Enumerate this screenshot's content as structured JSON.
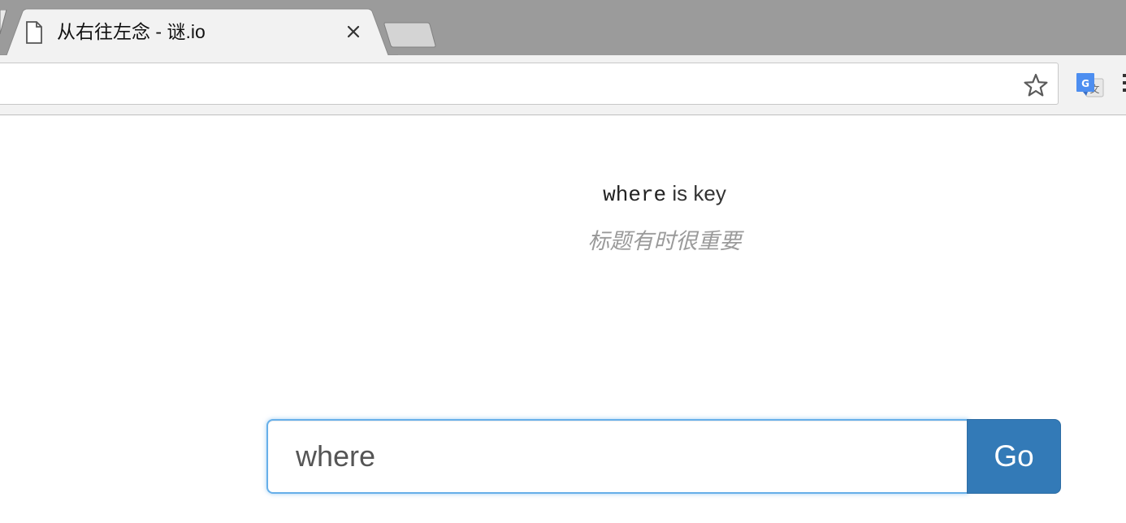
{
  "browser": {
    "tab": {
      "title": "从右往左念 - 谜.io",
      "favicon": "document-icon",
      "close_icon": "close-icon"
    },
    "new_tab_icon": "new-tab-icon",
    "toolbar": {
      "bookmark_icon": "star-icon",
      "extension_icon": "google-translate-icon",
      "menu_icon": "vertical-dots-menu-icon"
    }
  },
  "page": {
    "heading_code": "where",
    "heading_rest": " is key",
    "hint": "标题有时很重要",
    "answer": {
      "value": "where",
      "button_label": "Go"
    }
  },
  "colors": {
    "titlebar": "#9b9b9b",
    "toolbar": "#f2f2f2",
    "focus_border": "#66afe9",
    "button": "#337ab7",
    "hint_text": "#9a9a9a"
  }
}
